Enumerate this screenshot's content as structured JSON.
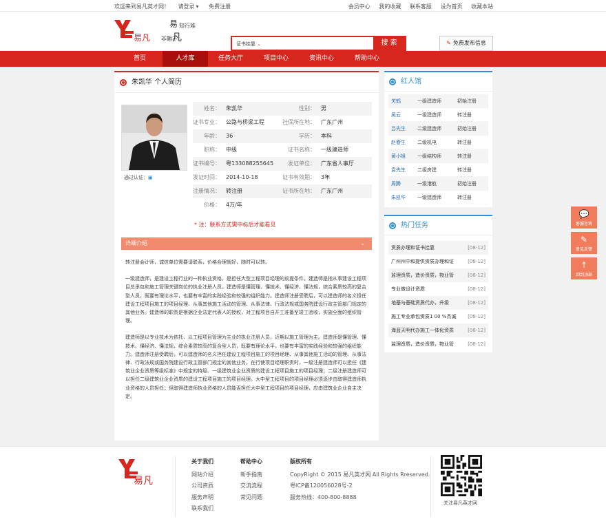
{
  "topbar": {
    "welcome": "欢迎来到易凡英才网！",
    "login": "请登录",
    "register": "免费注册",
    "links": [
      "会员中心",
      "我的收藏",
      "联系客服",
      "设为首页",
      "收藏本站"
    ]
  },
  "header": {
    "slogan_top": "知行难",
    "slogan_bottom": "易",
    "slogan_left": "非難不",
    "slogan_right": "凡",
    "search_select": "证书挂靠",
    "search_button": "搜 索",
    "publish": "免费发布信息"
  },
  "nav": [
    "首页",
    "人才库",
    "任务大厅",
    "项目中心",
    "资讯中心",
    "帮助中心"
  ],
  "nav_active": 1,
  "resume": {
    "title": "朱凯华 个人简历",
    "auth_label": "通过认证：",
    "rows": [
      {
        "k1": "姓名：",
        "v1": "朱凯华",
        "k2": "性别：",
        "v2": "男"
      },
      {
        "k1": "证书专业：",
        "v1": "公路与桥梁工程",
        "k2": "社保所在地：",
        "v2": "广东广州"
      },
      {
        "k1": "年龄：",
        "v1": "36",
        "k2": "学历：",
        "v2": "本科"
      },
      {
        "k1": "职称：",
        "v1": "中级",
        "k2": "证书名称：",
        "v2": "一级建造师"
      },
      {
        "k1": "证书编号：",
        "v1": "粤133088255645",
        "k2": "发证单位：",
        "v2": "广东省人事厅"
      },
      {
        "k1": "发证时间：",
        "v1": "2014-10-18",
        "k2": "证书有效期：",
        "v2": "3年"
      },
      {
        "k1": "注册情况：",
        "v1": "转注册",
        "k2": "证书所在地：",
        "v2": "广东广州"
      },
      {
        "k1": "价格：",
        "v1": "4万/年",
        "k2": "",
        "v2": ""
      }
    ],
    "note": "* 注：联系方式需中标后才能看见",
    "detail_title": "详细介绍",
    "paragraphs": [
      "转注册会计师，诚信单位需要请联系，价格合理就好，随时可以转。",
      "一级建造师，是建设工程行业的一种执业资格，是担任大型工程项目经理的前提条件。建造师是指从事建设工程项目总承包和施工管理关键岗位的执业注册人员。建造师是懂管理、懂技术、懂经济、懂法规，综合素质较高的复合型人员，既要有理论水平，也要有丰富的实践经验和较强的组织能力。建造师注册受聘后，可以建造师的名义担任建设工程项目施工的项目经理、从事其他施工活动的管理、从事法律、行政法规或国务院建设行政主管部门规定的其他业务。建造师的职责是根据企业法定代表人的授权，对工程项目自开工准备至竣工验收，实施全面的组织管理。",
      "建造师是以专业技术为依托、以工程项目管理为主业的执业注册人员，近期以施工管理为主。建造师是懂管理、懂技术、懂经济、懂法规，综合素质较高的复合型人员，既要有理论水平，也要有丰富的实践经验和较强的组织能力。建造师注册受聘后，可以建造师的名义担任建设工程项目施工的项目经理、从事其他施工活动的管理、从事法律、行政法规或国务院建设行政主管部门规定的其他业务。在行使项目经理职责时，一级注册建造师可以担任《建筑业企业资质等级标准》中规定的特级、一级建筑业企业资质的建设工程项目施工的项目经理；二级注册建造师可以担任二级建筑业企业资质的建设工程项目施工的项目经理。大中型工程项目的项目经理必须逐步由取得建造师执业资格的人员担任；但取得建造师执业资格的人员能否担任大中型工程项目的项目经理，应由建筑业企业自主决定。"
    ]
  },
  "hot_talent": {
    "title": "红人馆",
    "items": [
      {
        "name": "关鹤",
        "cert": "一级建造师",
        "status": "初始注册"
      },
      {
        "name": "吴云",
        "cert": "一级建造师",
        "status": "转注册"
      },
      {
        "name": "吕先生",
        "cert": "二级建造师",
        "status": "初始注册"
      },
      {
        "name": "赵春生",
        "cert": "二级机电",
        "status": "转注册"
      },
      {
        "name": "黄小姐",
        "cert": "一级结构师",
        "status": "转注册"
      },
      {
        "name": "袁先生",
        "cert": "二级房建",
        "status": "转注册"
      },
      {
        "name": "周腾",
        "cert": "一级港航",
        "status": "初始注册"
      },
      {
        "name": "朱凯华",
        "cert": "一级建造师",
        "status": "转注册"
      }
    ]
  },
  "hot_tasks": {
    "title": "热门任务",
    "items": [
      {
        "title": "资质办理和证书挂靠",
        "date": "[08-12]"
      },
      {
        "title": "广州州中和提供资质办理和证",
        "date": "[08-12]"
      },
      {
        "title": "监理资质，造价资质，物业管",
        "date": "[08-12]"
      },
      {
        "title": "专业做设计资质",
        "date": "[08-12]"
      },
      {
        "title": "地基与基础资质代办，升级",
        "date": "[08-12]"
      },
      {
        "title": "施工专业承包资质1 00 %杰诚",
        "date": "[08-12]"
      },
      {
        "title": "海蓝天明代办施工一体化资质",
        "date": "[08-12]"
      },
      {
        "title": "监理资质，造价资质，物业管",
        "date": "[08-12]"
      }
    ]
  },
  "float": [
    {
      "label": "客服咨询",
      "icon": "chat-icon"
    },
    {
      "label": "意见反馈",
      "icon": "feedback-icon"
    },
    {
      "label": "回到顶部",
      "icon": "up-arrow-icon"
    }
  ],
  "footer": {
    "about_title": "关于我们",
    "about": [
      "网站介绍",
      "公司资质",
      "服务声明",
      "联系我们"
    ],
    "help_title": "帮助中心",
    "help": [
      "新手指南",
      "交流流程",
      "常见问题"
    ],
    "rights_title": "版权所有",
    "rights": [
      "CopyRight © 2015 易凡英才网 All Rights Rreserved.",
      "粤ICP备120056028号-2",
      "服务热线：400-800-8888"
    ],
    "qr_caption": "关注易凡英才网"
  },
  "colors": {
    "brand": "#d7261e",
    "accent_blue": "#2e8ed8",
    "float": "#f07c5c"
  }
}
